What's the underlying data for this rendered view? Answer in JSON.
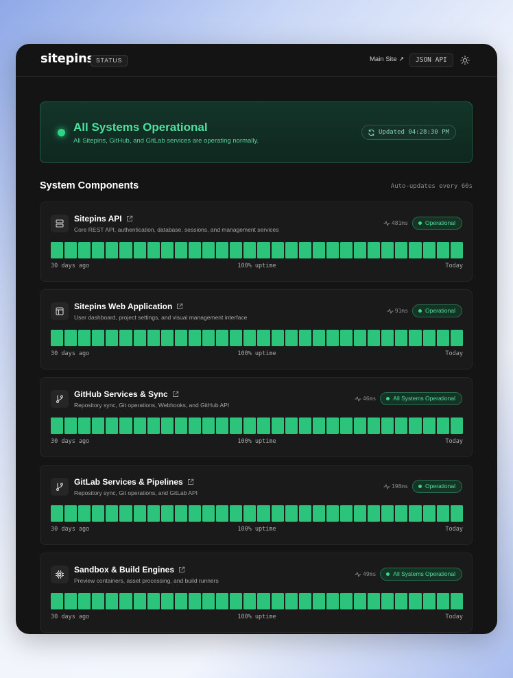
{
  "header": {
    "logo": "sitepins",
    "status_chip": "STATUS",
    "main_site_label": "Main Site ↗",
    "json_api_label": "JSON API",
    "theme_icon": "sun-icon"
  },
  "hero": {
    "title": "All Systems Operational",
    "subtitle": "All Sitepins, GitHub, and GitLab services are operating normally.",
    "updated_label": "Updated 04:28:30 PM",
    "status_color": "#2bd786"
  },
  "section": {
    "title": "System Components",
    "note": "Auto-updates every 60s"
  },
  "colors": {
    "uptime_bar": "#2cc47a",
    "badge_text": "#55dd9d"
  },
  "components": [
    {
      "icon": "server-icon",
      "name": "Sitepins API",
      "description": "Core REST API, authentication, database, sessions, and management services",
      "latency": "481ms",
      "status": "Operational",
      "days": 30,
      "left_label": "30 days ago",
      "uptime": "100% uptime",
      "right_label": "Today"
    },
    {
      "icon": "layout-icon",
      "name": "Sitepins Web Application",
      "description": "User dashboard, project settings, and visual management interface",
      "latency": "91ms",
      "status": "Operational",
      "days": 30,
      "left_label": "30 days ago",
      "uptime": "100% uptime",
      "right_label": "Today"
    },
    {
      "icon": "git-branch-icon",
      "name": "GitHub Services & Sync",
      "description": "Repository sync, Git operations, Webhooks, and GitHub API",
      "latency": "46ms",
      "status": "All Systems Operational",
      "days": 30,
      "left_label": "30 days ago",
      "uptime": "100% uptime",
      "right_label": "Today"
    },
    {
      "icon": "git-branch-icon",
      "name": "GitLab Services & Pipelines",
      "description": "Repository sync, Git operations, and GitLab API",
      "latency": "198ms",
      "status": "Operational",
      "days": 30,
      "left_label": "30 days ago",
      "uptime": "100% uptime",
      "right_label": "Today"
    },
    {
      "icon": "cpu-icon",
      "name": "Sandbox & Build Engines",
      "description": "Preview containers, asset processing, and build runners",
      "latency": "49ms",
      "status": "All Systems Operational",
      "days": 30,
      "left_label": "30 days ago",
      "uptime": "100% uptime",
      "right_label": "Today"
    }
  ]
}
